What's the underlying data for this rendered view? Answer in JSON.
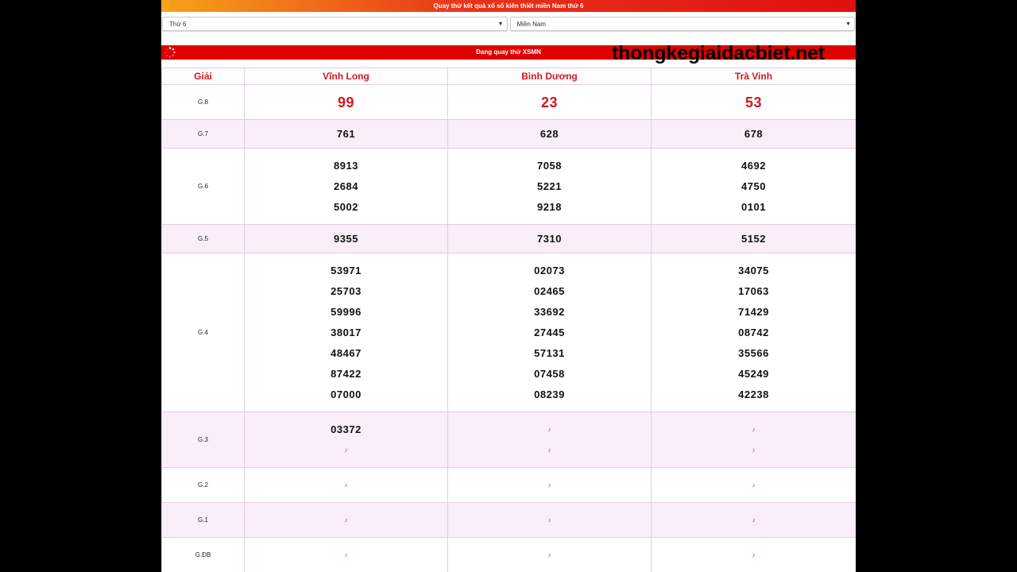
{
  "header": {
    "title": "Quay thử kết quả xổ số kiến thiết miền Nam thứ 6"
  },
  "selects": {
    "day": "Thứ 6",
    "region": "Miền Nam"
  },
  "status": {
    "text": "Đang quay thử XSMN"
  },
  "watermark": "thongkegiaidacbiet.net",
  "table": {
    "headers": [
      "Giải",
      "Vĩnh Long",
      "Bình Dương",
      "Trà Vinh"
    ],
    "pending_glyph": "♪",
    "rows": [
      {
        "label": "G.8",
        "big": true,
        "cells": [
          [
            "99"
          ],
          [
            "23"
          ],
          [
            "53"
          ]
        ]
      },
      {
        "label": "G.7",
        "cells": [
          [
            "761"
          ],
          [
            "628"
          ],
          [
            "678"
          ]
        ]
      },
      {
        "label": "G.6",
        "cells": [
          [
            "8913",
            "2684",
            "5002"
          ],
          [
            "7058",
            "5221",
            "9218"
          ],
          [
            "4692",
            "4750",
            "0101"
          ]
        ]
      },
      {
        "label": "G.5",
        "cells": [
          [
            "9355"
          ],
          [
            "7310"
          ],
          [
            "5152"
          ]
        ]
      },
      {
        "label": "G.4",
        "cells": [
          [
            "53971",
            "25703",
            "59996",
            "38017",
            "48467",
            "87422",
            "07000"
          ],
          [
            "02073",
            "02465",
            "33692",
            "27445",
            "57131",
            "07458",
            "08239"
          ],
          [
            "34075",
            "17063",
            "71429",
            "08742",
            "35566",
            "45249",
            "42238"
          ]
        ]
      },
      {
        "label": "G.3",
        "cells": [
          [
            "03372",
            null
          ],
          [
            null,
            null
          ],
          [
            null,
            null
          ]
        ]
      },
      {
        "label": "G.2",
        "cells": [
          [
            null
          ],
          [
            null
          ],
          [
            null
          ]
        ]
      },
      {
        "label": "G.1",
        "cells": [
          [
            null
          ],
          [
            null
          ],
          [
            null
          ]
        ]
      },
      {
        "label": "G.ĐB",
        "cells": [
          [
            null
          ],
          [
            null
          ],
          [
            null
          ]
        ]
      }
    ]
  }
}
